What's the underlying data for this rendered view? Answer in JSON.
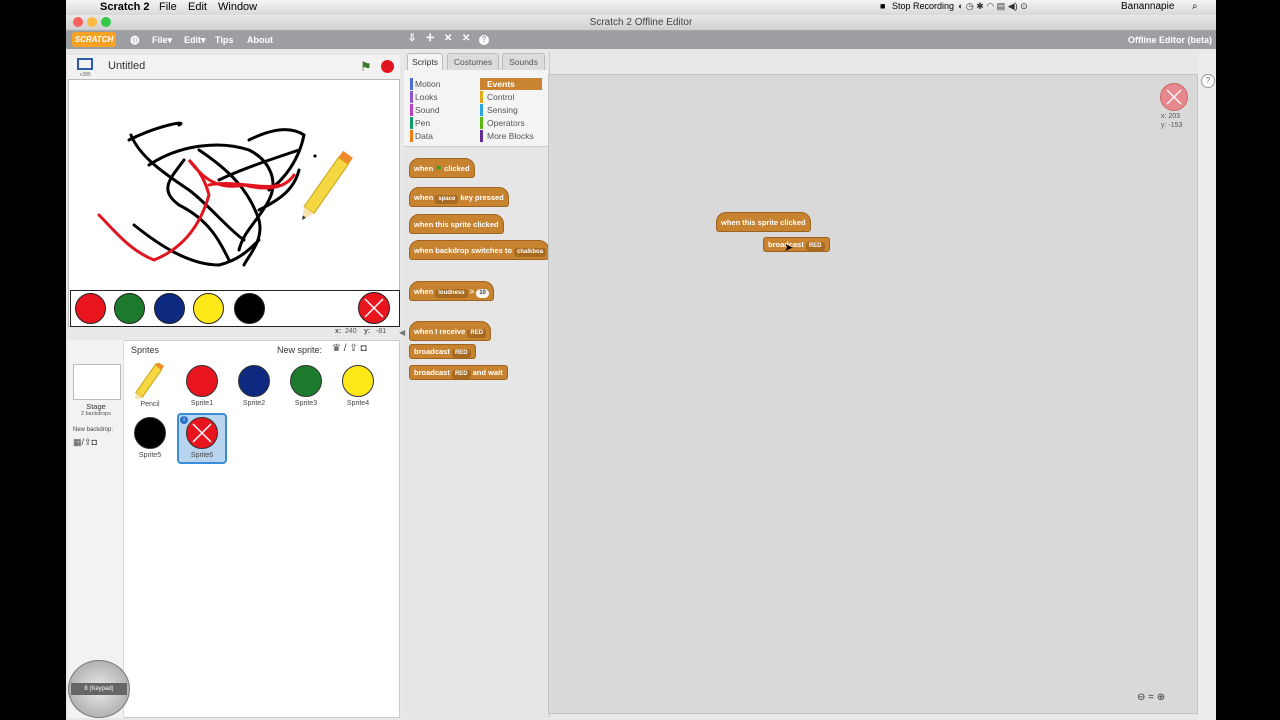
{
  "menubar": {
    "app": "Scratch 2",
    "items": [
      "File",
      "Edit",
      "Window"
    ],
    "stop_recording": "Stop Recording",
    "user": "Banannapie"
  },
  "window": {
    "title": "Scratch 2 Offline Editor"
  },
  "scratchbar": {
    "logo": "SCRATCH",
    "file": "File▾",
    "edit": "Edit▾",
    "tips": "Tips",
    "about": "About",
    "edition": "Offline Editor (beta)"
  },
  "stage": {
    "version": "v385",
    "title": "Untitled",
    "x_label": "x:",
    "x_value": "240",
    "y_label": "y:",
    "y_value": "-81"
  },
  "sprites": {
    "header": "Sprites",
    "new_sprite": "New sprite:",
    "stage_label": "Stage",
    "stage_sub": "2 backdrops",
    "new_backdrop": "New backdrop:",
    "items": [
      {
        "name": "Pencil",
        "color": "#f5d742"
      },
      {
        "name": "Sprite1",
        "color": "#e8141e"
      },
      {
        "name": "Sprite2",
        "color": "#0d2a80"
      },
      {
        "name": "Sprite3",
        "color": "#1b7a2b"
      },
      {
        "name": "Sprite4",
        "color": "#ffe817"
      },
      {
        "name": "Sprite5",
        "color": "#000000"
      },
      {
        "name": "Sprite6",
        "color": "#e8141e"
      }
    ]
  },
  "tabs": [
    "Scripts",
    "Costumes",
    "Sounds"
  ],
  "categories": {
    "left": [
      {
        "label": "Motion",
        "color": "#4a6cd4"
      },
      {
        "label": "Looks",
        "color": "#8a55d7"
      },
      {
        "label": "Sound",
        "color": "#bb42c3"
      },
      {
        "label": "Pen",
        "color": "#0e9a6c"
      },
      {
        "label": "Data",
        "color": "#ee7d16"
      }
    ],
    "right": [
      {
        "label": "Events",
        "color": "#c88330"
      },
      {
        "label": "Control",
        "color": "#e1a91a"
      },
      {
        "label": "Sensing",
        "color": "#2ca5e2"
      },
      {
        "label": "Operators",
        "color": "#5cb712"
      },
      {
        "label": "More Blocks",
        "color": "#632d99"
      }
    ]
  },
  "palette_blocks": {
    "flag_when": "when",
    "flag_clicked": "clicked",
    "key_when": "when",
    "key_space": "space",
    "key_pressed": "key pressed",
    "sprite_clicked": "when this sprite clicked",
    "backdrop_when": "when backdrop switches to",
    "backdrop_val": "chalkboa",
    "loud_when": "when",
    "loud_sel": "loudness",
    "loud_gt": ">",
    "loud_val": "10",
    "receive_when": "when I receive",
    "receive_val": "RED",
    "broadcast": "broadcast",
    "broadcast_val": "RED",
    "bwait": "broadcast",
    "bwait_val": "RED",
    "bwait_tail": "and wait"
  },
  "script_area": {
    "hat": "when this sprite clicked",
    "broadcast": "broadcast",
    "broadcast_val": "RED",
    "x_label": "x: 203",
    "y_label": "y: -153"
  },
  "keypad": {
    "label": "8 (Keypad)"
  }
}
